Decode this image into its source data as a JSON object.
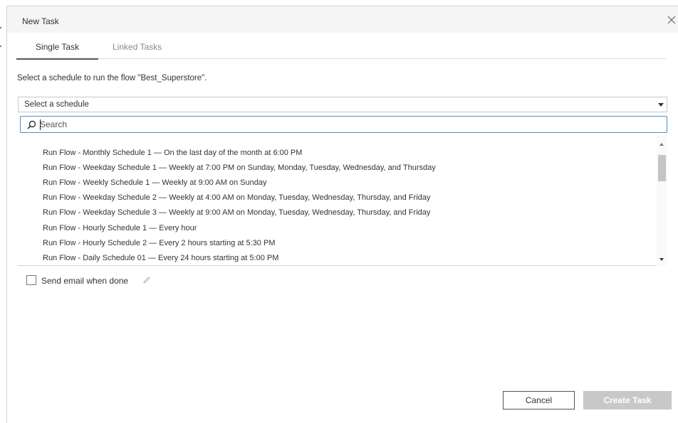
{
  "dialog": {
    "title": "New Task"
  },
  "tabs": [
    {
      "label": "Single Task",
      "active": true
    },
    {
      "label": "Linked Tasks",
      "active": false
    }
  ],
  "instruction": "Select a schedule to run the flow \"Best_Superstore\".",
  "schedule_select": {
    "value": "Select a schedule"
  },
  "search": {
    "placeholder": "Search",
    "value": ""
  },
  "schedule_options": [
    "Run Flow - Monthly Schedule 1 — On the last day of the month at 6:00 PM",
    "Run Flow - Weekday Schedule 1 — Weekly at 7:00 PM on Sunday, Monday, Tuesday, Wednesday, and Thursday",
    "Run Flow - Weekly Schedule 1 — Weekly at 9:00 AM on Sunday",
    "Run Flow - Weekday Schedule 2 — Weekly at 4:00 AM on Monday, Tuesday, Wednesday, Thursday, and Friday",
    "Run Flow - Weekday Schedule 3 — Weekly at 9:00 AM on Monday, Tuesday, Wednesday, Thursday, and Friday",
    "Run Flow - Hourly Schedule 1 — Every hour",
    "Run Flow - Hourly Schedule 2 — Every 2 hours starting at 5:30 PM",
    "Run Flow - Daily Schedule 01 — Every 24 hours starting at 5:00 PM"
  ],
  "email": {
    "label": "Send email when done",
    "checked": false
  },
  "buttons": {
    "cancel": "Cancel",
    "create": "Create Task"
  },
  "colors": {
    "focus_border": "#4a90c4",
    "disabled_button": "#c8c8c8",
    "header_bg": "#f5f5f5"
  },
  "icons": [
    "close-icon",
    "search-icon",
    "caret-down-icon",
    "pencil-icon"
  ]
}
